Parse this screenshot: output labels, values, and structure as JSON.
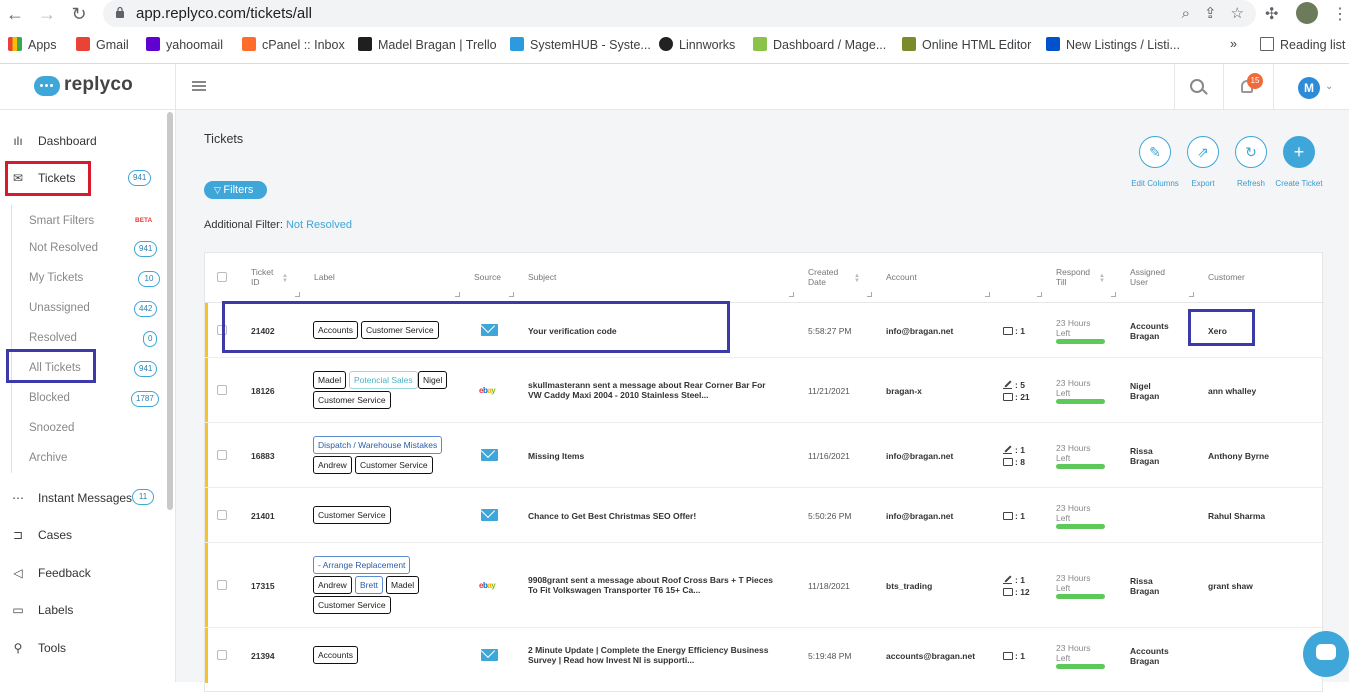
{
  "browser": {
    "url": "app.replyco.com/tickets/all",
    "bookmarks": [
      {
        "label": "Apps",
        "color": "#ea4335"
      },
      {
        "label": "Gmail",
        "color": "#ea4335"
      },
      {
        "label": "yahoomail",
        "color": "#6001d2"
      },
      {
        "label": "cPanel :: Inbox",
        "color": "#ff6c2c"
      },
      {
        "label": "Madel Bragan | Trello",
        "color": "#1f1f1f"
      },
      {
        "label": "SystemHUB - Syste...",
        "color": "#2b9be0"
      },
      {
        "label": "Linnworks",
        "color": "#222"
      },
      {
        "label": "Dashboard / Mage...",
        "color": "#8bc34a"
      },
      {
        "label": "Online HTML Editor",
        "color": "#7a8b2c"
      },
      {
        "label": "New Listings / Listi...",
        "color": "#0052cc"
      }
    ],
    "more": "»",
    "reading_list": "Reading list"
  },
  "app": {
    "logo": "replyco",
    "notifications": "15",
    "user_initial": "M"
  },
  "sidebar": {
    "items": [
      {
        "label": "Dashboard",
        "icon": "bar-chart-icon"
      },
      {
        "label": "Tickets",
        "icon": "mail-icon",
        "count": "941"
      },
      {
        "label": "Instant Messages",
        "icon": "chat-icon",
        "count": "11"
      },
      {
        "label": "Cases",
        "icon": "cases-icon"
      },
      {
        "label": "Feedback",
        "icon": "megaphone-icon"
      },
      {
        "label": "Labels",
        "icon": "folder-icon"
      },
      {
        "label": "Tools",
        "icon": "wrench-icon"
      }
    ],
    "sub": [
      {
        "label": "Smart Filters",
        "badge": "BETA"
      },
      {
        "label": "Not Resolved",
        "count": "941"
      },
      {
        "label": "My Tickets",
        "count": "10"
      },
      {
        "label": "Unassigned",
        "count": "442"
      },
      {
        "label": "Resolved",
        "count": "0"
      },
      {
        "label": "All Tickets",
        "count": "941"
      },
      {
        "label": "Blocked",
        "count": "1787"
      },
      {
        "label": "Snoozed"
      },
      {
        "label": "Archive"
      }
    ]
  },
  "main": {
    "title": "Tickets",
    "actions": [
      {
        "label": "Edit Columns",
        "icon": "edit-icon"
      },
      {
        "label": "Export",
        "icon": "export-icon"
      },
      {
        "label": "Refresh",
        "icon": "refresh-icon"
      },
      {
        "label": "Create Ticket",
        "icon": "plus-icon"
      }
    ],
    "filters_label": "Filters",
    "additional_filter_label": "Additional Filter:",
    "additional_filter_value": "Not Resolved",
    "columns": {
      "ticket_id": "Ticket ID",
      "label": "Label",
      "source": "Source",
      "subject": "Subject",
      "created": "Created Date",
      "account": "Account",
      "respond": "Respond Till",
      "assigned": "Assigned User",
      "customer": "Customer"
    },
    "rows": [
      {
        "id": "21402",
        "tags": [
          [
            "Accounts",
            "Customer Service"
          ]
        ],
        "source": "email",
        "subject": [
          "Your verification code"
        ],
        "created": "5:58:27 PM",
        "account": "info@bragan.net",
        "notes": "",
        "msgs": ": 1",
        "respond": [
          "23 Hours",
          "Left"
        ],
        "assigned": [
          "Accounts",
          "Bragan"
        ],
        "customer": "Xero"
      },
      {
        "id": "18126",
        "tags": [
          [
            "Madel",
            "Potencial Sales",
            "Nigel"
          ],
          [
            "Customer Service"
          ]
        ],
        "source": "ebay",
        "subject": [
          "skullmasterann sent a message about Rear Corner Bar For",
          "VW Caddy Maxi 2004 - 2010 Stainless Steel..."
        ],
        "created": "11/21/2021",
        "account": "bragan-x",
        "notes": ": 5",
        "msgs": ": 21",
        "respond": [
          "23 Hours",
          "Left"
        ],
        "assigned": [
          "Nigel",
          "Bragan"
        ],
        "customer": "ann whalley"
      },
      {
        "id": "16883",
        "tags": [
          [
            "Dispatch / Warehouse Mistakes"
          ],
          [
            "Andrew",
            "Customer Service"
          ]
        ],
        "source": "email",
        "subject": [
          "Missing Items"
        ],
        "created": "11/16/2021",
        "account": "info@bragan.net",
        "notes": ": 1",
        "msgs": ": 8",
        "respond": [
          "23 Hours",
          "Left"
        ],
        "assigned": [
          "Rissa",
          "Bragan"
        ],
        "customer": "Anthony Byrne"
      },
      {
        "id": "21401",
        "tags": [
          [
            "Customer Service"
          ]
        ],
        "source": "email",
        "subject": [
          "Chance to Get Best Christmas SEO Offer!"
        ],
        "created": "5:50:26 PM",
        "account": "info@bragan.net",
        "notes": "",
        "msgs": ": 1",
        "respond": [
          "23 Hours",
          "Left"
        ],
        "assigned": [
          "",
          ""
        ],
        "customer": "Rahul Sharma"
      },
      {
        "id": "17315",
        "tags": [
          [
            "- Arrange Replacement"
          ],
          [
            "Andrew",
            "Brett",
            "Madel"
          ],
          [
            "Customer Service"
          ]
        ],
        "source": "ebay",
        "subject": [
          "9908grant sent a message about Roof Cross Bars + T Pieces",
          "To Fit Volkswagen Transporter T6 15+ Ca..."
        ],
        "created": "11/18/2021",
        "account": "bts_trading",
        "notes": ": 1",
        "msgs": ": 12",
        "respond": [
          "23 Hours",
          "Left"
        ],
        "assigned": [
          "Rissa",
          "Bragan"
        ],
        "customer": "grant shaw"
      },
      {
        "id": "21394",
        "tags": [
          [
            "Accounts"
          ]
        ],
        "source": "email",
        "subject": [
          "2 Minute Update | Complete the Energy Efficiency Business",
          "Survey | Read how Invest NI is supporti..."
        ],
        "created": "5:19:48 PM",
        "account": "accounts@bragan.net",
        "notes": "",
        "msgs": ": 1",
        "respond": [
          "23 Hours",
          "Left"
        ],
        "assigned": [
          "Accounts",
          "Bragan"
        ],
        "customer": ""
      }
    ]
  },
  "colors": {
    "accent": "#3ea6d8",
    "highlight_red": "#d81b2c",
    "highlight_blue": "#3b3aa8",
    "row_bar": "#f4c430"
  }
}
